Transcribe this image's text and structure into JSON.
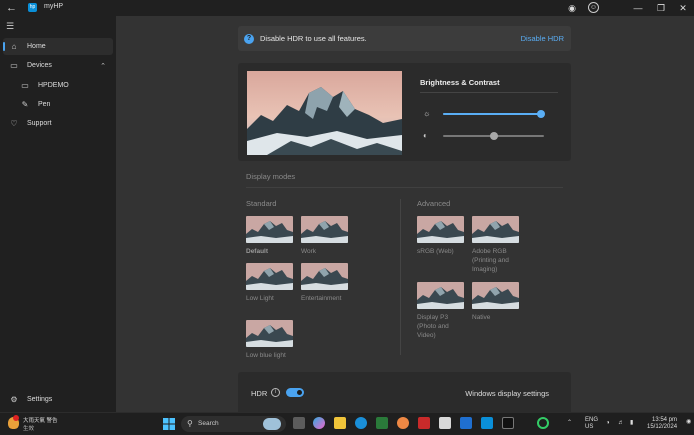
{
  "window": {
    "title": "myHP",
    "logo_text": "hp"
  },
  "sidebar": {
    "items": [
      {
        "label": "Home",
        "icon": "home-icon"
      },
      {
        "label": "Devices",
        "icon": "laptop-icon"
      },
      {
        "label": "HPDEMO",
        "icon": "laptop-icon"
      },
      {
        "label": "Pen",
        "icon": "pen-icon"
      },
      {
        "label": "Support",
        "icon": "support-icon"
      },
      {
        "label": "Settings",
        "icon": "gear-icon"
      }
    ]
  },
  "banner": {
    "text": "Disable HDR to use all features.",
    "link": "Disable HDR"
  },
  "brightness": {
    "title": "Brightness & Contrast",
    "brightness_level": 0.97,
    "contrast_level": 0.5,
    "accent": "#5aaef5"
  },
  "display_modes": {
    "title": "Display modes",
    "standard_title": "Standard",
    "advanced_title": "Advanced",
    "standard": [
      "Default",
      "Work",
      "Low Light",
      "Entertainment",
      "Low blue light"
    ],
    "advanced": [
      "sRGB (Web)",
      "Adobe RGB (Printing and Imaging)",
      "Display P3 (Photo and Video)",
      "Native"
    ],
    "selected": "Default"
  },
  "hdr": {
    "label": "HDR",
    "enabled": true,
    "link": "Windows display settings"
  },
  "taskbar": {
    "weather_line1": "大雨天氣 警告",
    "weather_line2": "生效",
    "search_placeholder": "Search",
    "lang": "ENG",
    "region": "US",
    "time": "13:54 pm",
    "date": "15/12/2024"
  }
}
